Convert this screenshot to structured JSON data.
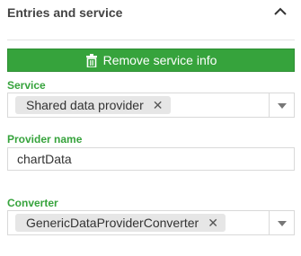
{
  "header": {
    "title": "Entries and service",
    "collapse_icon": "chevron-up-icon"
  },
  "remove_button": {
    "label": "Remove service info",
    "icon": "trash-icon"
  },
  "service": {
    "label": "Service",
    "selected": "Shared data provider",
    "remove_icon": "close-icon",
    "dropdown_icon": "chevron-down-icon"
  },
  "provider_name": {
    "label": "Provider name",
    "value": "chartData"
  },
  "converter": {
    "label": "Converter",
    "selected": "GenericDataProviderConverter",
    "remove_icon": "close-icon",
    "dropdown_icon": "chevron-down-icon"
  },
  "colors": {
    "accent": "#36a33c",
    "border": "#d9d9d9",
    "chip": "#e6e6e6"
  }
}
